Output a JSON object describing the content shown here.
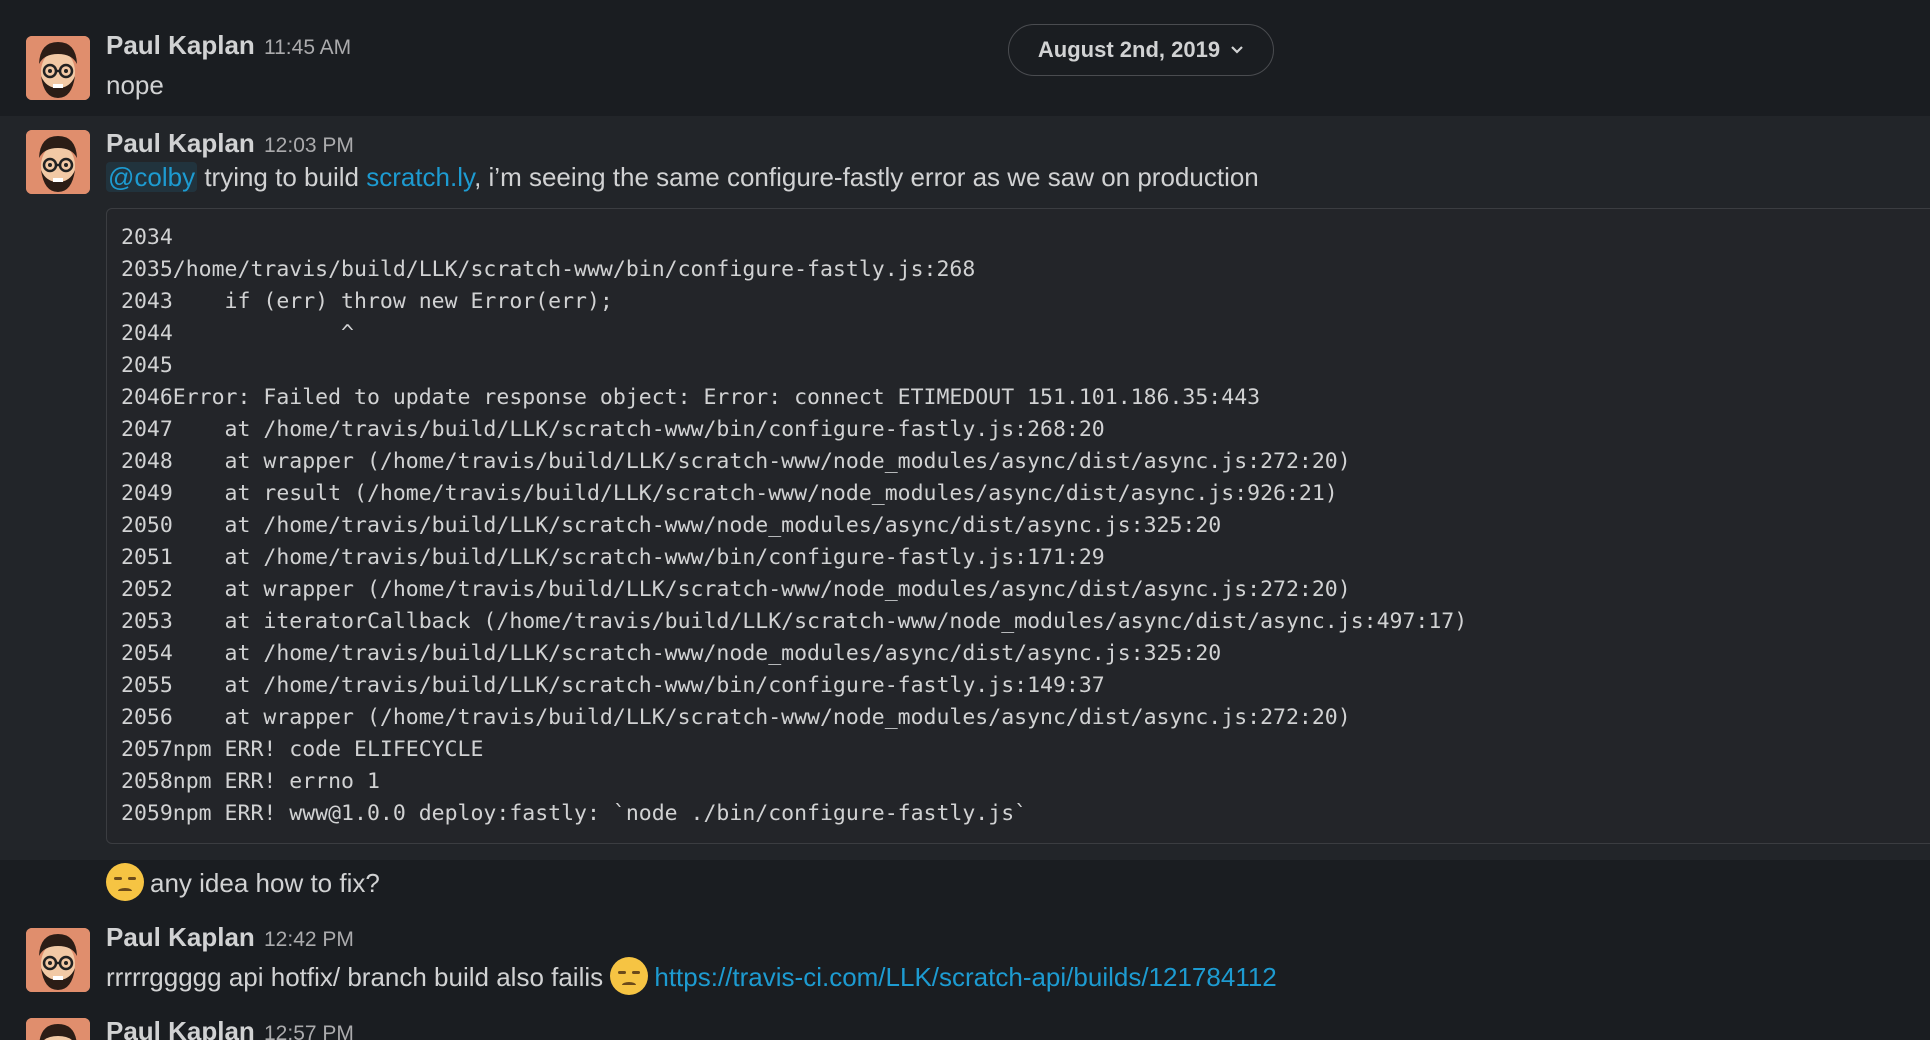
{
  "date_divider": {
    "label": "August 2nd, 2019",
    "icon": "chevron-down-icon"
  },
  "messages": [
    {
      "author": "Paul Kaplan",
      "time": "11:45 AM",
      "text": "nope"
    },
    {
      "author": "Paul Kaplan",
      "time": "12:03 PM",
      "mention": "@colby",
      "text_a": " trying to build ",
      "link": "scratch.ly",
      "text_b": ", i’m seeing the same configure-fastly error as we saw on production",
      "code_lines": [
        "2034",
        "2035/home/travis/build/LLK/scratch-www/bin/configure-fastly.js:268",
        "2043    if (err) throw new Error(err);",
        "2044             ^",
        "2045",
        "2046Error: Failed to update response object: Error: connect ETIMEDOUT 151.101.186.35:443",
        "2047    at /home/travis/build/LLK/scratch-www/bin/configure-fastly.js:268:20",
        "2048    at wrapper (/home/travis/build/LLK/scratch-www/node_modules/async/dist/async.js:272:20)",
        "2049    at result (/home/travis/build/LLK/scratch-www/node_modules/async/dist/async.js:926:21)",
        "2050    at /home/travis/build/LLK/scratch-www/node_modules/async/dist/async.js:325:20",
        "2051    at /home/travis/build/LLK/scratch-www/bin/configure-fastly.js:171:29",
        "2052    at wrapper (/home/travis/build/LLK/scratch-www/node_modules/async/dist/async.js:272:20)",
        "2053    at iteratorCallback (/home/travis/build/LLK/scratch-www/node_modules/async/dist/async.js:497:17)",
        "2054    at /home/travis/build/LLK/scratch-www/node_modules/async/dist/async.js:325:20",
        "2055    at /home/travis/build/LLK/scratch-www/bin/configure-fastly.js:149:37",
        "2056    at wrapper (/home/travis/build/LLK/scratch-www/node_modules/async/dist/async.js:272:20)",
        "2057npm ERR! code ELIFECYCLE",
        "2058npm ERR! errno 1",
        "2059npm ERR! www@1.0.0 deploy:fastly: `node ./bin/configure-fastly.js`"
      ]
    },
    {
      "emoji": "disappointed-emoji",
      "text": "any idea how to fix?"
    },
    {
      "author": "Paul Kaplan",
      "time": "12:42 PM",
      "text": "rrrrrggggg api hotfix/ branch build also failis",
      "emoji": "disappointed-emoji",
      "link": "https://travis-ci.com/LLK/scratch-api/builds/121784112"
    },
    {
      "author": "Paul Kaplan",
      "time": "12:57 PM"
    }
  ],
  "colors": {
    "background": "#1a1d21",
    "hover": "#222529",
    "link": "#1d9bd1",
    "avatar_bg": "#e08e6d"
  }
}
